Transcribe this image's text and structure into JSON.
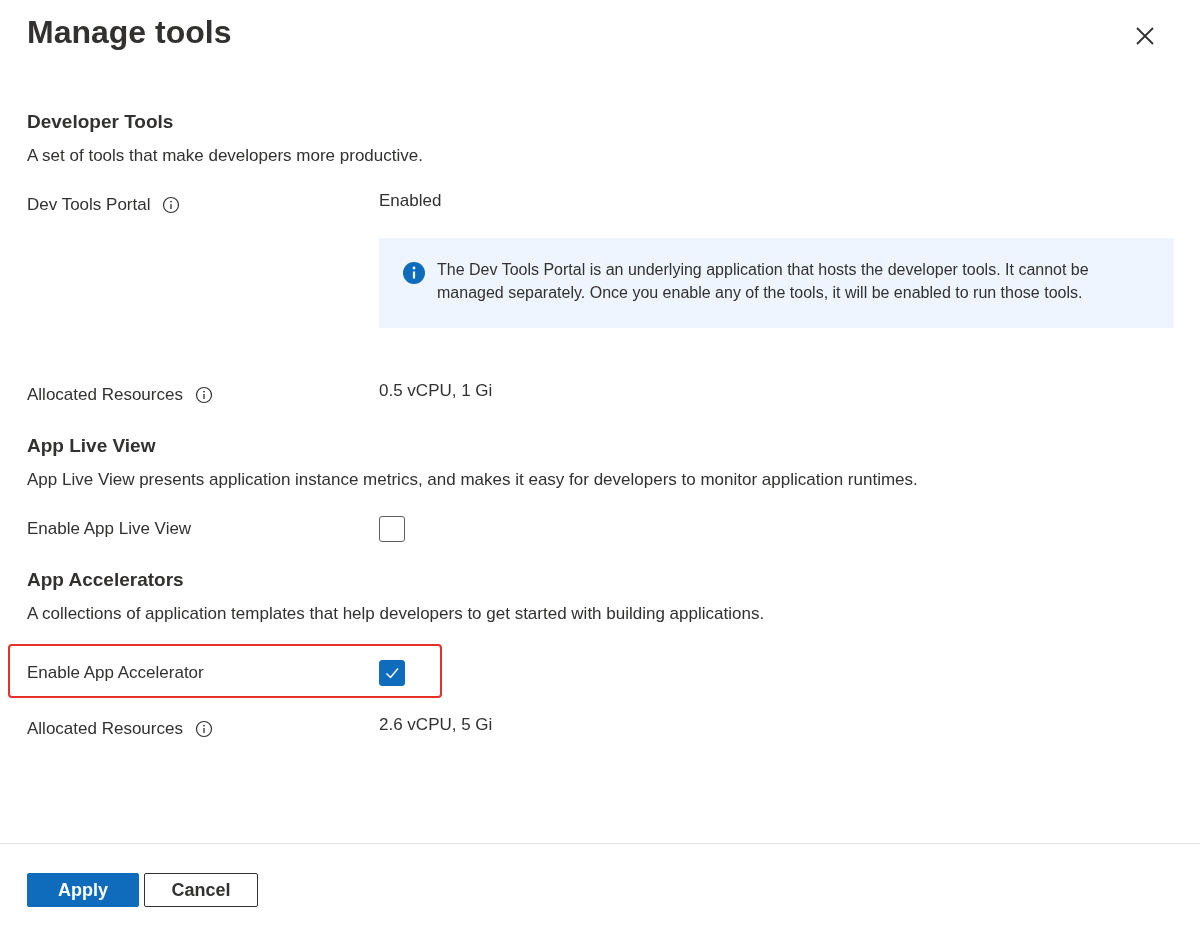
{
  "dialog": {
    "title": "Manage tools"
  },
  "sections": [
    {
      "heading": "Developer Tools",
      "description": "A set of tools that make developers more productive.",
      "rows": [
        {
          "kind": "value",
          "label": "Dev Tools Portal",
          "info": true,
          "value": "Enabled"
        },
        {
          "kind": "note",
          "text": "The Dev Tools Portal is an underlying application that hosts the developer tools. It cannot be managed separately. Once you enable any of the tools, it will be enabled to run those tools."
        },
        {
          "kind": "value",
          "label": "Allocated Resources",
          "info": true,
          "value": "0.5 vCPU, 1 Gi"
        }
      ]
    },
    {
      "heading": "App Live View",
      "description": "App Live View presents application instance metrics, and makes it easy for developers to monitor application runtimes.",
      "rows": [
        {
          "kind": "checkbox",
          "label": "Enable App Live View",
          "checked": false,
          "highlighted": false
        }
      ]
    },
    {
      "heading": "App Accelerators",
      "description": "A collections of application templates that help developers to get started with building applications.",
      "rows": [
        {
          "kind": "checkbox",
          "label": "Enable App Accelerator",
          "checked": true,
          "highlighted": true
        },
        {
          "kind": "value",
          "label": "Allocated Resources",
          "info": true,
          "value": "2.6 vCPU, 5 Gi"
        }
      ]
    }
  ],
  "buttons": [
    {
      "label": "Apply",
      "kind": "primary"
    },
    {
      "label": "Cancel",
      "kind": "secondary"
    }
  ]
}
